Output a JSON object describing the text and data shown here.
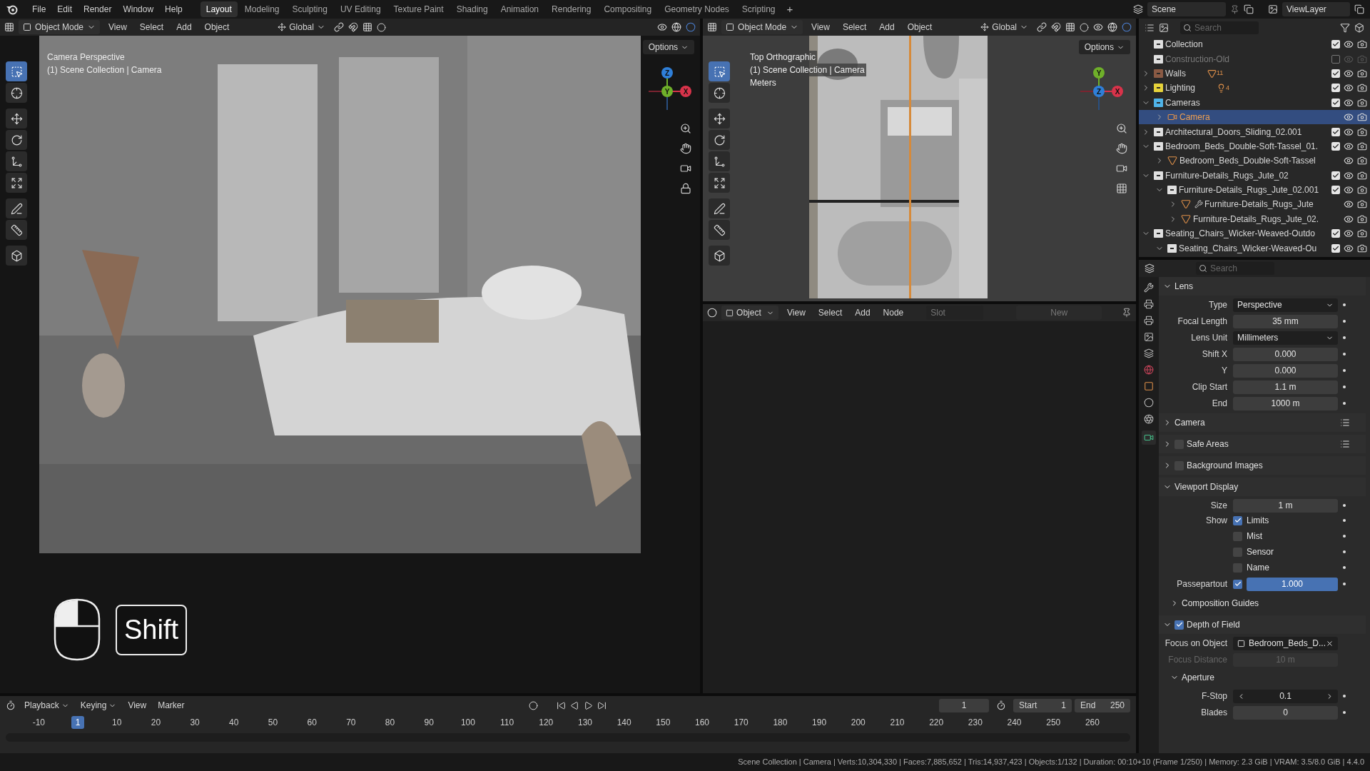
{
  "topbar": {
    "menus": [
      "File",
      "Edit",
      "Render",
      "Window",
      "Help"
    ],
    "workspaces": [
      {
        "label": "Layout",
        "selected": true
      },
      {
        "label": "Modeling",
        "selected": false
      },
      {
        "label": "Sculpting",
        "selected": false
      },
      {
        "label": "UV Editing",
        "selected": false
      },
      {
        "label": "Texture Paint",
        "selected": false
      },
      {
        "label": "Shading",
        "selected": false
      },
      {
        "label": "Animation",
        "selected": false
      },
      {
        "label": "Rendering",
        "selected": false
      },
      {
        "label": "Compositing",
        "selected": false
      },
      {
        "label": "Geometry Nodes",
        "selected": false
      },
      {
        "label": "Scripting",
        "selected": false
      }
    ],
    "add_tab": "+",
    "scene": "Scene",
    "view_layer": "ViewLayer"
  },
  "viewport": {
    "mode": "Object Mode",
    "menus": [
      "View",
      "Select",
      "Add",
      "Object"
    ],
    "orientation": "Global",
    "options": "Options",
    "view_name": "Camera Perspective",
    "collection_info": "(1) Scene Collection | Camera",
    "gizmo": [
      {
        "label": "Z",
        "color": "#2f7fd8"
      },
      {
        "label": "Y",
        "color": "#6fb02a"
      },
      {
        "label": "X",
        "color": "#d8334a"
      }
    ]
  },
  "screencast": {
    "key": "Shift"
  },
  "top_view": {
    "mode": "Object Mode",
    "menus": [
      "View",
      "Select",
      "Add",
      "Object"
    ],
    "orientation": "Global",
    "options": "Options",
    "view_name": "Top Orthographic",
    "collection_info": "(1) Scene Collection | Camera",
    "units": "Meters",
    "gizmo": [
      {
        "label": "Y",
        "color": "#6fb02a"
      },
      {
        "label": "Z",
        "color": "#2f7fd8"
      },
      {
        "label": "X",
        "color": "#d8334a"
      }
    ]
  },
  "node_editor": {
    "type": "Object",
    "menus": [
      "View",
      "Select",
      "Add",
      "Node"
    ],
    "slot": "Slot",
    "new": "New"
  },
  "outliner": {
    "search": {
      "placeholder": "Search"
    },
    "rows": [
      {
        "kind": "collection",
        "label": "Collection",
        "color": "#e0e0e0",
        "checked": true,
        "selected": false
      },
      {
        "kind": "collection",
        "label": "Construction-Old",
        "color": "#e0e0e0",
        "checked": false,
        "selected": false
      },
      {
        "kind": "collection",
        "label": "Walls",
        "color": "#8a5a44",
        "checked": true,
        "selected": false,
        "expanded": false,
        "badge": {
          "kind": "mesh",
          "count": "11"
        }
      },
      {
        "kind": "collection",
        "label": "Lighting",
        "color": "#e6d23a",
        "checked": true,
        "selected": false,
        "expanded": false,
        "badge": {
          "kind": "light",
          "count": "4"
        }
      },
      {
        "kind": "collection",
        "label": "Cameras",
        "color": "#4fb3e8",
        "checked": true,
        "selected": false,
        "expanded": true,
        "children": [
          {
            "kind": "camera",
            "label": "Camera",
            "selected": true,
            "expanded": false
          }
        ]
      },
      {
        "kind": "collection",
        "label": "Architectural_Doors_Sliding_02.001",
        "color": "#e0e0e0",
        "checked": true,
        "selected": false,
        "expanded": false
      },
      {
        "kind": "collection",
        "label": "Bedroom_Beds_Double-Soft-Tassel_01.",
        "color": "#e0e0e0",
        "checked": true,
        "selected": false,
        "expanded": true,
        "children": [
          {
            "kind": "mesh",
            "label": "Bedroom_Beds_Double-Soft-Tassel",
            "selected": false,
            "expanded": false
          }
        ]
      },
      {
        "kind": "collection",
        "label": "Furniture-Details_Rugs_Jute_02",
        "color": "#e0e0e0",
        "checked": true,
        "selected": false,
        "expanded": true,
        "children": [
          {
            "kind": "collection",
            "label": "Furniture-Details_Rugs_Jute_02.001",
            "color": "#e0e0e0",
            "checked": true,
            "selected": false,
            "expanded": true,
            "children": [
              {
                "kind": "mesh",
                "label": "Furniture-Details_Rugs_Jute",
                "selected": false,
                "expanded": false,
                "modifier": true
              },
              {
                "kind": "mesh",
                "label": "Furniture-Details_Rugs_Jute_02.",
                "selected": false,
                "expanded": false
              }
            ]
          }
        ]
      },
      {
        "kind": "collection",
        "label": "Seating_Chairs_Wicker-Weaved-Outdo",
        "color": "#e0e0e0",
        "checked": true,
        "selected": false,
        "expanded": true,
        "children": [
          {
            "kind": "collection",
            "label": "Seating_Chairs_Wicker-Weaved-Ou",
            "color": "#e0e0e0",
            "checked": true,
            "selected": false,
            "expanded": true
          }
        ]
      }
    ]
  },
  "properties": {
    "search": {
      "placeholder": "Search"
    },
    "items": [
      {
        "kind": "panel",
        "title": "Lens",
        "expanded": true
      },
      {
        "kind": "dropdown",
        "label": "Type",
        "value": "Perspective"
      },
      {
        "kind": "number",
        "label": "Focal Length",
        "value": "35 mm"
      },
      {
        "kind": "dropdown",
        "label": "Lens Unit",
        "value": "Millimeters"
      },
      {
        "kind": "number",
        "label": "Shift X",
        "value": "0.000"
      },
      {
        "kind": "number",
        "label": "Y",
        "value": "0.000"
      },
      {
        "kind": "number",
        "label": "Clip Start",
        "value": "1.1 m"
      },
      {
        "kind": "number",
        "label": "End",
        "value": "1000 m"
      },
      {
        "kind": "panel",
        "title": "Camera",
        "expanded": false,
        "presets": true
      },
      {
        "kind": "panel",
        "title": "Safe Areas",
        "expanded": false,
        "checked": false,
        "presets": true
      },
      {
        "kind": "panel",
        "title": "Background Images",
        "expanded": false,
        "checked": false
      },
      {
        "kind": "panel",
        "title": "Viewport Display",
        "expanded": true
      },
      {
        "kind": "number",
        "label": "Size",
        "value": "1 m"
      },
      {
        "kind": "check",
        "label": "Show",
        "text": "Limits",
        "checked": true
      },
      {
        "kind": "check",
        "text": "Mist",
        "checked": false
      },
      {
        "kind": "check",
        "text": "Sensor",
        "checked": false
      },
      {
        "kind": "check",
        "text": "Name",
        "checked": false
      },
      {
        "kind": "slider",
        "label": "Passepartout",
        "checked": true,
        "value": "1.000",
        "level": 1
      },
      {
        "kind": "subpanel",
        "title": "Composition Guides",
        "expanded": false
      },
      {
        "kind": "panel",
        "title": "Depth of Field",
        "expanded": true,
        "checked": true
      },
      {
        "kind": "object",
        "label": "Focus on Object",
        "value": "Bedroom_Beds_D..."
      },
      {
        "kind": "number",
        "label": "Focus Distance",
        "value": "10 m",
        "disabled": true
      },
      {
        "kind": "subpanel",
        "title": "Aperture",
        "expanded": true
      },
      {
        "kind": "stepper",
        "label": "F-Stop",
        "value": "0.1"
      },
      {
        "kind": "number",
        "label": "Blades",
        "value": "0"
      }
    ]
  },
  "timeline": {
    "menus": [
      "Playback",
      "Keying",
      "View",
      "Marker"
    ],
    "current_frame": "1",
    "start_label": "Start",
    "start": "1",
    "end_label": "End",
    "end": "250",
    "frames": [
      {
        "label": "-10",
        "selected": false
      },
      {
        "label": "1",
        "selected": true
      },
      {
        "label": "10",
        "selected": false
      },
      {
        "label": "20",
        "selected": false
      },
      {
        "label": "30",
        "selected": false
      },
      {
        "label": "40",
        "selected": false
      },
      {
        "label": "50",
        "selected": false
      },
      {
        "label": "60",
        "selected": false
      },
      {
        "label": "70",
        "selected": false
      },
      {
        "label": "80",
        "selected": false
      },
      {
        "label": "90",
        "selected": false
      },
      {
        "label": "100",
        "selected": false
      },
      {
        "label": "110",
        "selected": false
      },
      {
        "label": "120",
        "selected": false
      },
      {
        "label": "130",
        "selected": false
      },
      {
        "label": "140",
        "selected": false
      },
      {
        "label": "150",
        "selected": false
      },
      {
        "label": "160",
        "selected": false
      },
      {
        "label": "170",
        "selected": false
      },
      {
        "label": "180",
        "selected": false
      },
      {
        "label": "190",
        "selected": false
      },
      {
        "label": "200",
        "selected": false
      },
      {
        "label": "210",
        "selected": false
      },
      {
        "label": "220",
        "selected": false
      },
      {
        "label": "230",
        "selected": false
      },
      {
        "label": "240",
        "selected": false
      },
      {
        "label": "250",
        "selected": false
      },
      {
        "label": "260",
        "selected": false
      }
    ]
  },
  "status_bar": "Scene Collection | Camera | Verts:10,304,330 | Faces:7,885,652 | Tris:14,937,423 | Objects:1/132 | Duration: 00:10+10 (Frame 1/250) | Memory: 2.3 GiB | VRAM: 3.5/8.0 GiB | 4.4.0"
}
